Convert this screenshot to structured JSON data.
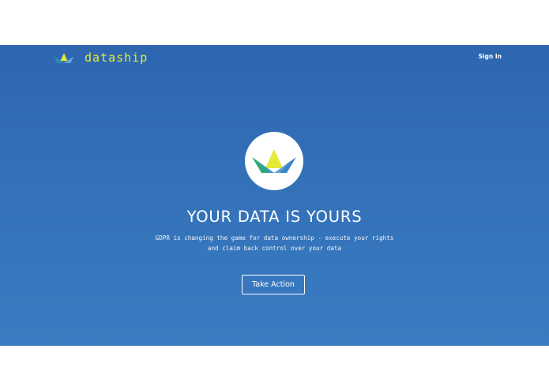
{
  "nav": {
    "brand": "dataship",
    "brand_icon": "boat-icon",
    "signin_label": "Sign In"
  },
  "hero": {
    "logo_icon": "paper-boat-icon",
    "headline": "YOUR DATA IS YOURS",
    "subline_1": "GDPR is changing the game for data ownership - execute your rights",
    "subline_2": "and claim back control over your data",
    "cta_label": "Take Action"
  },
  "colors": {
    "hero_background": "#3070b7",
    "brand_text": "#e3ea37",
    "boat_yellow": "#e3ea37",
    "boat_green": "#2fa77e",
    "boat_blue": "#3e86c6"
  }
}
